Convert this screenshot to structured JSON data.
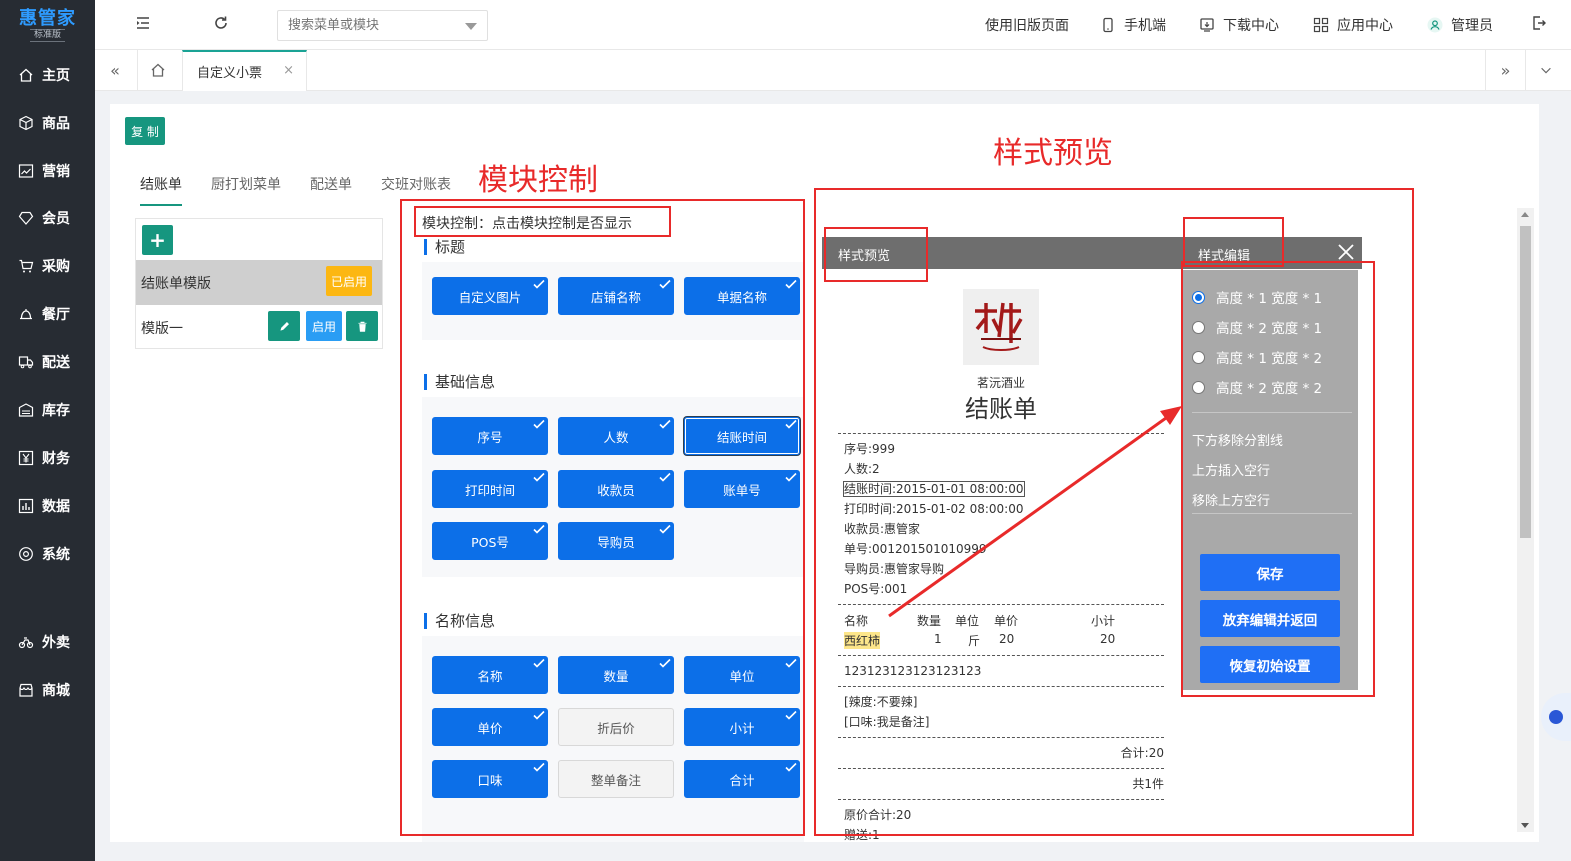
{
  "sidebar": {
    "brand": "惠管家",
    "edition": "标准版",
    "items": [
      {
        "label": "主页",
        "icon": "home-icon"
      },
      {
        "label": "商品",
        "icon": "box-icon"
      },
      {
        "label": "营销",
        "icon": "chart-icon"
      },
      {
        "label": "会员",
        "icon": "diamond-icon"
      },
      {
        "label": "采购",
        "icon": "cart-icon"
      },
      {
        "label": "餐厅",
        "icon": "bell-icon"
      },
      {
        "label": "配送",
        "icon": "truck-icon"
      },
      {
        "label": "库存",
        "icon": "warehouse-icon"
      },
      {
        "label": "财务",
        "icon": "yen-icon"
      },
      {
        "label": "数据",
        "icon": "bar-chart-icon"
      },
      {
        "label": "系统",
        "icon": "settings-icon"
      },
      {
        "label": "外卖",
        "icon": "bike-icon"
      },
      {
        "label": "商城",
        "icon": "shop-icon"
      }
    ]
  },
  "header": {
    "search_placeholder": "搜索菜单或模块",
    "old_version": "使用旧版页面",
    "mobile": "手机端",
    "downloads": "下载中心",
    "apps": "应用中心",
    "user": "管理员"
  },
  "tabs": {
    "active": "自定义小票",
    "close": "×"
  },
  "page": {
    "copy_button": "复 制",
    "receipt_tabs": [
      "结账单",
      "厨打划菜单",
      "配送单",
      "交班对账表"
    ],
    "add_symbol": "+",
    "templates": [
      {
        "name": "结账单模版",
        "status": "已启用"
      },
      {
        "name": "模版一",
        "enable": "启用"
      }
    ]
  },
  "module_control": {
    "hint": "模块控制：点击模块控制是否显示",
    "sections": [
      {
        "title": "标题",
        "buttons": [
          {
            "label": "自定义图片",
            "on": true
          },
          {
            "label": "店铺名称",
            "on": true
          },
          {
            "label": "单据名称",
            "on": true
          }
        ]
      },
      {
        "title": "基础信息",
        "buttons": [
          {
            "label": "序号",
            "on": true
          },
          {
            "label": "人数",
            "on": true
          },
          {
            "label": "结账时间",
            "on": true
          },
          {
            "label": "打印时间",
            "on": true
          },
          {
            "label": "收款员",
            "on": true
          },
          {
            "label": "账单号",
            "on": true
          },
          {
            "label": "POS号",
            "on": true
          },
          {
            "label": "导购员",
            "on": true
          }
        ]
      },
      {
        "title": "名称信息",
        "buttons": [
          {
            "label": "名称",
            "on": true
          },
          {
            "label": "数量",
            "on": true
          },
          {
            "label": "单位",
            "on": true
          },
          {
            "label": "单价",
            "on": true
          },
          {
            "label": "折后价",
            "on": false
          },
          {
            "label": "小计",
            "on": true
          },
          {
            "label": "口味",
            "on": true
          },
          {
            "label": "整单备注",
            "on": false
          },
          {
            "label": "合计",
            "on": true
          }
        ]
      }
    ]
  },
  "preview": {
    "header_left": "样式预览",
    "header_right": "样式编辑",
    "store": "茗沅酒业",
    "doc_title": "结账单",
    "info_lines": [
      "序号:999",
      "人数:2",
      "结账时间:2015-01-01 08:00:00",
      "打印时间:2015-01-02 08:00:00",
      "收款员:惠管家",
      "单号:001201501010999",
      "导购员:惠管家导购",
      "POS号:001"
    ],
    "item_headers": [
      "名称",
      "数量",
      "单位",
      "单价",
      "小计"
    ],
    "item_row": [
      "西红柿",
      "1",
      "斤",
      "20",
      "20"
    ],
    "barcode_line": "123123123123123123",
    "remarks": [
      "[辣度:不要辣]",
      "[口味:我是备注]"
    ],
    "total": "合计:20",
    "count": "共1件",
    "original_total": "原价合计:20",
    "gift": "赠送:1"
  },
  "editor": {
    "options": [
      "高度 * 1 宽度 * 1",
      "高度 * 2 宽度 * 1",
      "高度 * 1 宽度 * 2",
      "高度 * 2 宽度 * 2"
    ],
    "actions": [
      "下方移除分割线",
      "上方插入空行",
      "移除上方空行"
    ],
    "save": "保存",
    "discard": "放弃编辑并返回",
    "reset": "恢复初始设置"
  },
  "annotations": {
    "module_control": "模块控制",
    "style_preview": "样式预览"
  },
  "colors": {
    "sidebar_bg": "#272c33",
    "accent_green": "#16967f",
    "module_blue": "#0c6fe8",
    "enabled_yellow": "#fcb712",
    "annotation_red": "#e82a2a"
  }
}
